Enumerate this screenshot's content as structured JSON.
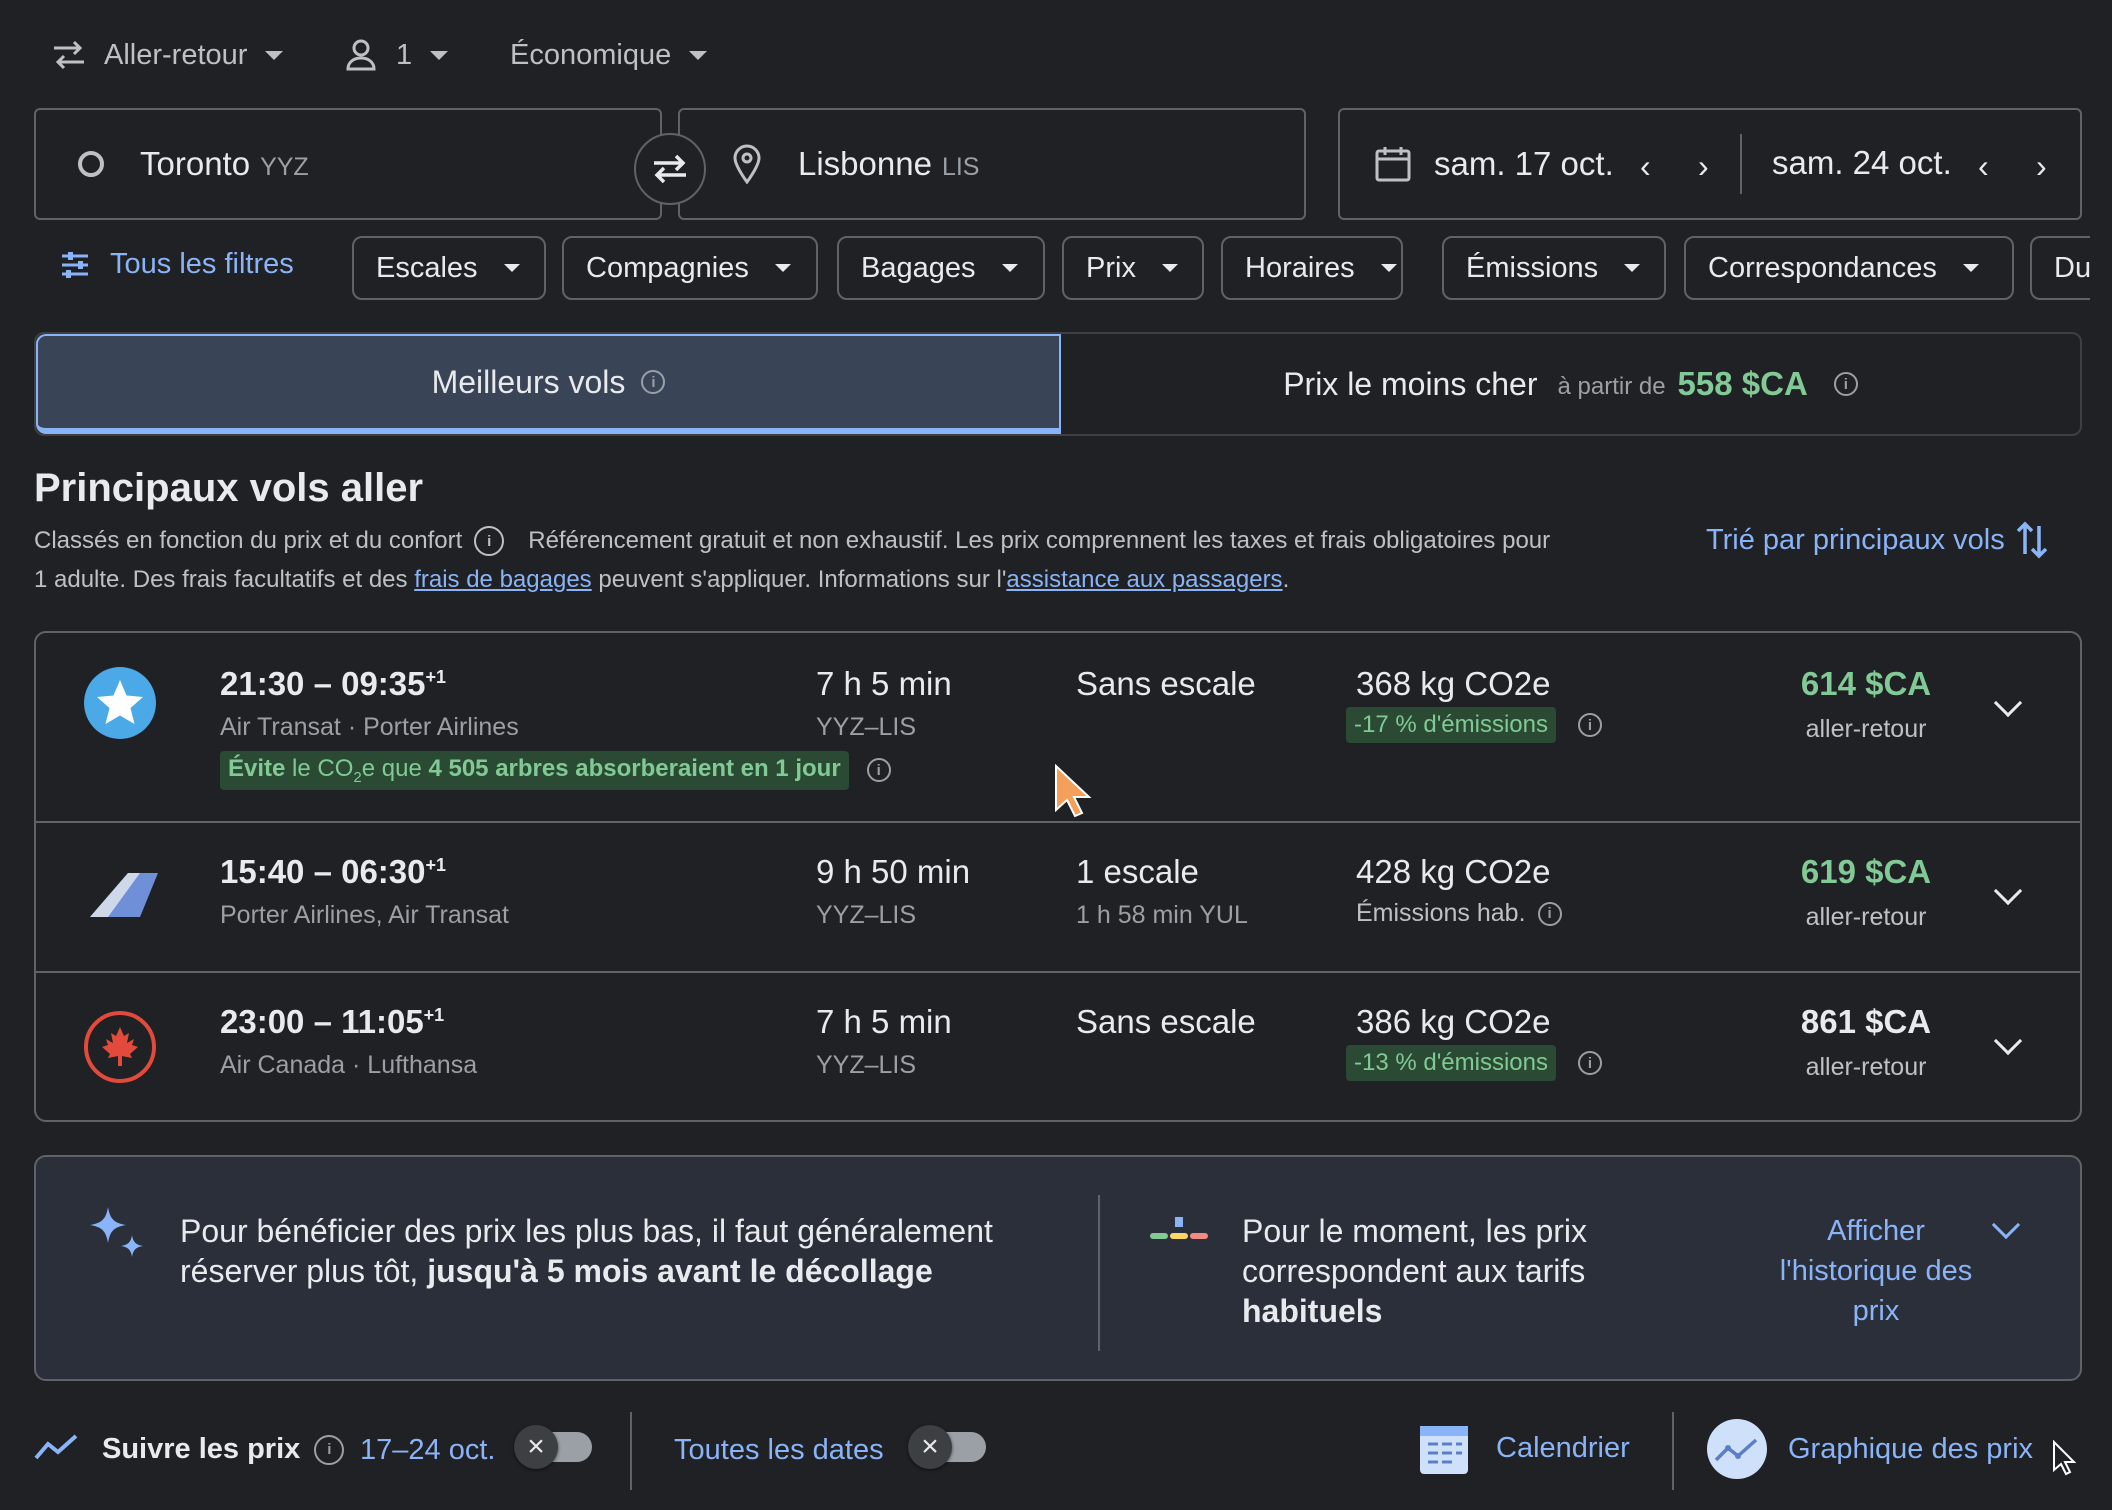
{
  "trip": {
    "type": "Aller-retour",
    "passengers": "1",
    "cabin": "Économique"
  },
  "origin": {
    "city": "Toronto",
    "code": "YYZ"
  },
  "destination": {
    "city": "Lisbonne",
    "code": "LIS"
  },
  "dates": {
    "depart": "sam. 17 oct.",
    "return": "sam. 24 oct."
  },
  "filters": {
    "all": "Tous les filtres",
    "chips": [
      "Escales",
      "Compagnies",
      "Bagages",
      "Prix",
      "Horaires",
      "Émissions",
      "Correspondances",
      "Du"
    ]
  },
  "tabs": {
    "best": "Meilleurs vols",
    "cheapest": "Prix le moins cher",
    "from": "à partir de",
    "cheapest_price": "558 $CA"
  },
  "section": {
    "title": "Principaux vols aller",
    "ranked": "Classés en fonction du prix et du confort",
    "note1": "Référencement gratuit et non exhaustif. Les prix comprennent les taxes et frais obligatoires pour",
    "note2a": "1 adulte. Des frais facultatifs et des ",
    "link_bags": "frais de bagages",
    "note2b": " peuvent s'appliquer. Informations sur l'",
    "link_assist": "assistance aux passagers",
    "note2c": ".",
    "sort": "Trié par principaux vols"
  },
  "flights": [
    {
      "times": "21:30 – 09:35",
      "plus": "+1",
      "airlines": "Air Transat · Porter Airlines",
      "duration": "7 h 5 min",
      "route": "YYZ–LIS",
      "stops": "Sans escale",
      "stop_detail": "",
      "co2": "368 kg CO2e",
      "emissions": "-17 % d'émissions",
      "price": "614 $CA",
      "price_label": "aller-retour",
      "eco_a": "Évite",
      "eco_b": " le CO",
      "eco_sub": "2",
      "eco_c": "e que ",
      "eco_d": "4 505 arbres absorberaient en 1 jour"
    },
    {
      "times": "15:40 – 06:30",
      "plus": "+1",
      "airlines": "Porter Airlines, Air Transat",
      "duration": "9 h 50 min",
      "route": "YYZ–LIS",
      "stops": "1 escale",
      "stop_detail": "1 h 58 min YUL",
      "co2": "428 kg CO2e",
      "emissions": "Émissions hab.",
      "price": "619 $CA",
      "price_label": "aller-retour"
    },
    {
      "times": "23:00 – 11:05",
      "plus": "+1",
      "airlines": "Air Canada · Lufthansa",
      "duration": "7 h 5 min",
      "route": "YYZ–LIS",
      "stops": "Sans escale",
      "stop_detail": "",
      "co2": "386 kg CO2e",
      "emissions": "-13 % d'émissions",
      "price": "861 $CA",
      "price_label": "aller-retour"
    }
  ],
  "insights": {
    "tip_a": "Pour bénéficier des prix les plus bas, il faut généralement",
    "tip_b": "réserver plus tôt, ",
    "tip_bold": "jusqu'à 5 mois avant le décollage",
    "status_a": "Pour le moment, les prix",
    "status_b": "correspondent aux tarifs",
    "status_bold": "habituels",
    "history_1": "Afficher",
    "history_2": "l'historique des",
    "history_3": "prix"
  },
  "bottom": {
    "track": "Suivre les prix",
    "range": "17–24 oct.",
    "all_dates": "Toutes les dates",
    "calendar": "Calendrier",
    "graph": "Graphique des prix"
  }
}
